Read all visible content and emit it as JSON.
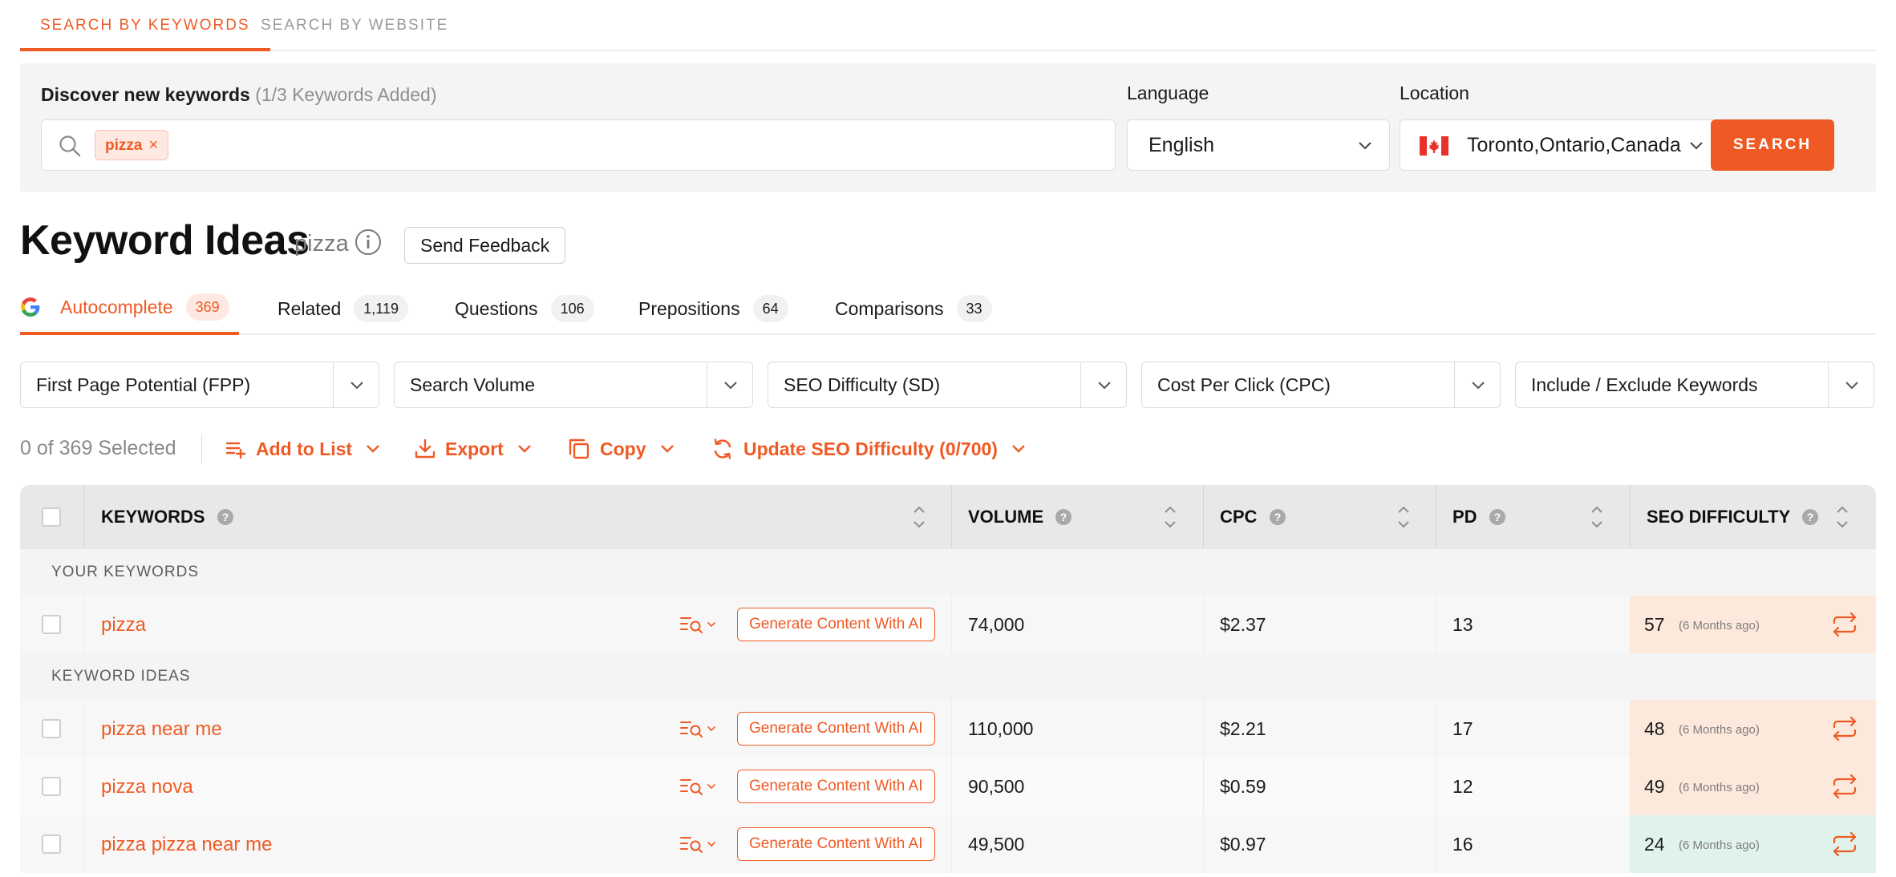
{
  "top_tabs": [
    {
      "label": "SEARCH BY KEYWORDS",
      "active": true
    },
    {
      "label": "SEARCH BY WEBSITE",
      "active": false
    }
  ],
  "search": {
    "discover_label": "Discover new keywords",
    "discover_count": "(1/3 Keywords Added)",
    "chip": "pizza",
    "language_label": "Language",
    "language_value": "English",
    "location_label": "Location",
    "location_value": "Toronto,Ontario,Canada",
    "button": "SEARCH"
  },
  "header": {
    "title": "Keyword Ideas",
    "seed": "pizza",
    "feedback": "Send Feedback"
  },
  "sub_tabs": [
    {
      "label": "Autocomplete",
      "count": "369",
      "active": true
    },
    {
      "label": "Related",
      "count": "1,119"
    },
    {
      "label": "Questions",
      "count": "106"
    },
    {
      "label": "Prepositions",
      "count": "64"
    },
    {
      "label": "Comparisons",
      "count": "33"
    }
  ],
  "filters": [
    "First Page Potential (FPP)",
    "Search Volume",
    "SEO Difficulty (SD)",
    "Cost Per Click (CPC)",
    "Include / Exclude Keywords"
  ],
  "actions": {
    "selected": "0 of 369 Selected",
    "add_to_list": "Add to List",
    "export": "Export",
    "copy": "Copy",
    "update_sd": "Update SEO Difficulty (0/700)"
  },
  "table": {
    "headers": {
      "keywords": "KEYWORDS",
      "volume": "VOLUME",
      "cpc": "CPC",
      "pd": "PD",
      "sd": "SEO DIFFICULTY"
    },
    "section_your": "YOUR KEYWORDS",
    "section_ideas": "KEYWORD IDEAS",
    "generate_label": "Generate Content With AI",
    "rows": [
      {
        "keyword": "pizza",
        "volume": "74,000",
        "cpc": "$2.37",
        "pd": "13",
        "sd": "57",
        "updated": "(6 Months ago)",
        "sd_color": "#fde9dc"
      },
      {
        "keyword": "pizza near me",
        "volume": "110,000",
        "cpc": "$2.21",
        "pd": "17",
        "sd": "48",
        "updated": "(6 Months ago)",
        "sd_color": "#fde9dc"
      },
      {
        "keyword": "pizza nova",
        "volume": "90,500",
        "cpc": "$0.59",
        "pd": "12",
        "sd": "49",
        "updated": "(6 Months ago)",
        "sd_color": "#fde9dc"
      },
      {
        "keyword": "pizza pizza near me",
        "volume": "49,500",
        "cpc": "$0.97",
        "pd": "16",
        "sd": "24",
        "updated": "(6 Months ago)",
        "sd_color": "#dff3ec"
      }
    ]
  },
  "colors": {
    "accent": "#ef5a24",
    "sd_medium": "#fde9dc",
    "sd_easy": "#dff3ec"
  }
}
